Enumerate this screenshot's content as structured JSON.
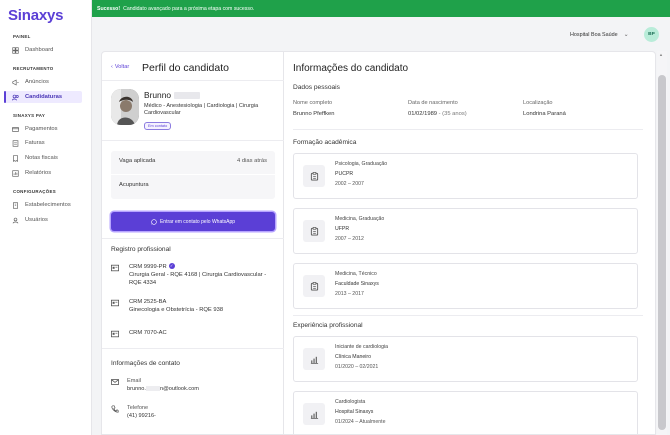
{
  "app": {
    "logo": "Sinaxys"
  },
  "sidebar": {
    "sections": [
      {
        "title": "PAINEL",
        "items": [
          {
            "label": "Dashboard",
            "icon": "dashboard-icon"
          }
        ]
      },
      {
        "title": "RECRUTAMENTO",
        "items": [
          {
            "label": "Anúncios",
            "icon": "megaphone-icon"
          },
          {
            "label": "Candidaturas",
            "icon": "users-icon",
            "active": true
          }
        ]
      },
      {
        "title": "SINAXYS PAY",
        "items": [
          {
            "label": "Pagamentos",
            "icon": "card-icon"
          },
          {
            "label": "Faturas",
            "icon": "invoice-icon"
          },
          {
            "label": "Notas fiscais",
            "icon": "receipt-icon"
          },
          {
            "label": "Relatórios",
            "icon": "report-icon"
          }
        ]
      },
      {
        "title": "CONFIGURAÇÕES",
        "items": [
          {
            "label": "Estabelecimentos",
            "icon": "building-icon"
          },
          {
            "label": "Usuários",
            "icon": "user-icon"
          }
        ]
      }
    ]
  },
  "toast": {
    "strong": "Sucesso!",
    "message": "Candidato avançado para a próxima etapa com sucesso."
  },
  "header": {
    "org": "Hospital Boa Saúde",
    "avatar": "BP"
  },
  "profile": {
    "back": "Voltar",
    "title": "Perfil do candidato",
    "name": "Brunno",
    "specialty": "Médico - Anestesiologia | Cardiologia | Cirurgia Cardiovascular",
    "status_badge": "Em contato",
    "vaga_label": "Vaga aplicada",
    "vaga_time": "4 dias atrás",
    "vaga_job": "Acupuntura",
    "whatsapp_button": "Entrar em contato pelo WhatsApp",
    "registro_title": "Registro profissional",
    "registros": [
      {
        "crm": "CRM 9999-PR",
        "verified": true,
        "detail": "Cirurgia Geral - RQE 4168 | Cirurgia Cardiovascular - RQE 4334"
      },
      {
        "crm": "CRM 2525-BA",
        "verified": false,
        "detail": "Ginecologia e Obstetrícia - RQE 938"
      },
      {
        "crm": "CRM 7070-AC",
        "verified": false,
        "detail": ""
      }
    ],
    "contato_title": "Informações de contato",
    "email_label": "Email",
    "email_prefix": "brunno.",
    "email_suffix": "n@outlook.com",
    "phone_label": "Telefone",
    "phone_value": "(41) 99216-"
  },
  "info": {
    "title": "Informações do candidato",
    "dados_title": "Dados pessoais",
    "fields": {
      "nome_label": "Nome completo",
      "nome_value": "Brunno Pfeffken",
      "nasc_label": "Data de nascimento",
      "nasc_value": "01/02/1989",
      "nasc_age": "- (35 anos)",
      "loc_label": "Localização",
      "loc_value": "Londrina Paraná"
    },
    "formacao_title": "Formação acadêmica",
    "formacao": [
      {
        "course": "Psicologia, Graduação",
        "school": "PUCPR",
        "period": "2002 – 2007"
      },
      {
        "course": "Medicina, Graduação",
        "school": "UFPR",
        "period": "2007 – 2012"
      },
      {
        "course": "Medicina, Técnico",
        "school": "Faculdade Sinaxys",
        "period": "2013 – 2017"
      }
    ],
    "experiencia_title": "Experiência profissional",
    "experiencia": [
      {
        "role": "Iniciante de cardiologia",
        "place": "Clínica Maneiro",
        "period": "01/2020 – 02/2021"
      },
      {
        "role": "Cardiologista",
        "place": "Hospital Sinaxys",
        "period": "01/2024 – Atualmente"
      }
    ]
  },
  "colors": {
    "brand": "#5b3fd6",
    "success": "#1fa14a",
    "avatar_bg": "#b9ecd9"
  }
}
